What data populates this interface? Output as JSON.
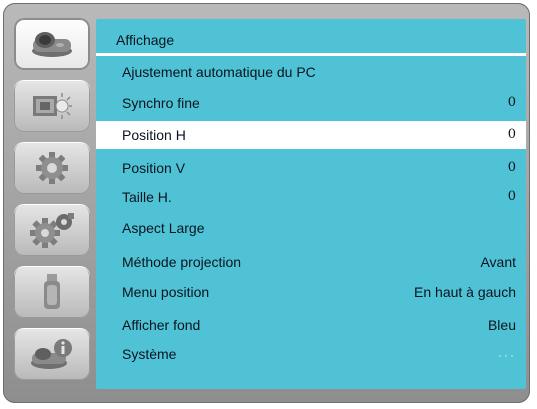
{
  "sidebar": {
    "items": [
      {
        "icon": "display-icon",
        "active": true
      },
      {
        "icon": "image-adjust-icon",
        "active": false
      },
      {
        "icon": "gear-icon",
        "active": false
      },
      {
        "icon": "gear-advanced-icon",
        "active": false
      },
      {
        "icon": "usb-icon",
        "active": false
      },
      {
        "icon": "info-icon",
        "active": false
      }
    ]
  },
  "panel": {
    "title": "Affichage",
    "items": [
      {
        "label": "Ajustement automatique du PC",
        "value": ""
      },
      {
        "label": "Synchro fine",
        "value": "0"
      },
      {
        "label": "Position H",
        "value": "0",
        "selected": true
      },
      {
        "label": "Position V",
        "value": "0"
      },
      {
        "label": "Taille H.",
        "value": "0"
      },
      {
        "label": "Aspect Large",
        "value": ""
      },
      {
        "label": "Méthode  projection",
        "value": "Avant"
      },
      {
        "label": "Menu position",
        "value": "En haut à gauch"
      },
      {
        "label": "Afficher fond",
        "value": "Bleu"
      },
      {
        "label": "Système",
        "value": "···"
      }
    ]
  },
  "colors": {
    "panel_bg": "#4fc3d5",
    "selected_bg": "#ffffff",
    "frame_bg": "#a6a6a6"
  }
}
